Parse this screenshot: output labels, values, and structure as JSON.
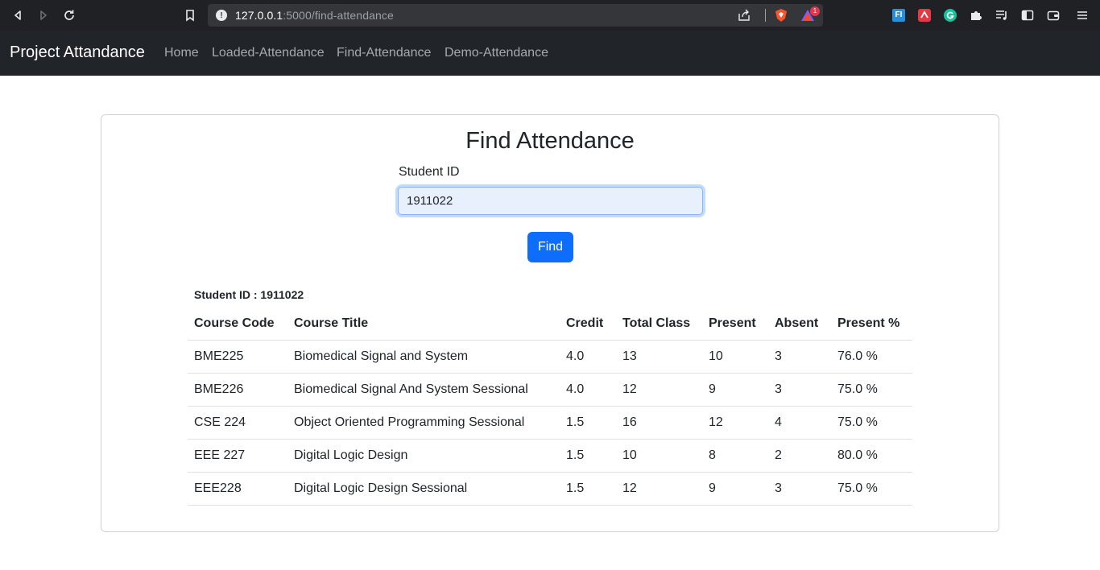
{
  "browser": {
    "url_host": "127.0.0.1",
    "url_path": ":5000/find-attendance",
    "notification_count": "1",
    "ext_fi": "FI"
  },
  "navbar": {
    "brand": "Project Attandance",
    "links": [
      "Home",
      "Loaded-Attendance",
      "Find-Attendance",
      "Demo-Attendance"
    ]
  },
  "form": {
    "title": "Find Attendance",
    "student_id_label": "Student ID",
    "student_id_value": "1911022",
    "find_label": "Find"
  },
  "result": {
    "student_id_text": "Student ID : 1911022",
    "headers": [
      "Course Code",
      "Course Title",
      "Credit",
      "Total Class",
      "Present",
      "Absent",
      "Present %"
    ],
    "rows": [
      [
        "BME225",
        "Biomedical Signal and System",
        "4.0",
        "13",
        "10",
        "3",
        "76.0 %"
      ],
      [
        "BME226",
        "Biomedical Signal And System Sessional",
        "4.0",
        "12",
        "9",
        "3",
        "75.0 %"
      ],
      [
        "CSE 224",
        "Object Oriented Programming Sessional",
        "1.5",
        "16",
        "12",
        "4",
        "75.0 %"
      ],
      [
        "EEE 227",
        "Digital Logic Design",
        "1.5",
        "10",
        "8",
        "2",
        "80.0 %"
      ],
      [
        "EEE228",
        "Digital Logic Design Sessional",
        "1.5",
        "12",
        "9",
        "3",
        "75.0 %"
      ]
    ]
  },
  "colors": {
    "navbar_bg": "#212529",
    "primary": "#0d6efd",
    "chrome_bg": "#202124"
  }
}
